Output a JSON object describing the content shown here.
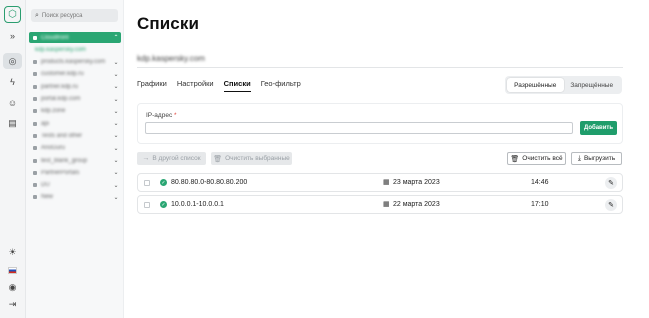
{
  "sidebar": {
    "search_placeholder": "Поиск ресурса",
    "domains": [
      {
        "label": "Cloudfront",
        "selected": true
      },
      {
        "label": "kdp.kaspersky.com",
        "sub": true
      },
      {
        "label": "products.kaspersky.com"
      },
      {
        "label": "customer.kdp.ru"
      },
      {
        "label": "partner.kdp.ru"
      },
      {
        "label": "portal.kdp.com"
      },
      {
        "label": "kdp.zone"
      },
      {
        "label": "api"
      },
      {
        "label": "Tests and other"
      },
      {
        "label": "AnoGuru"
      },
      {
        "label": "test_blank_group"
      },
      {
        "label": "PartnerPortals"
      },
      {
        "label": "DU"
      },
      {
        "label": "New"
      }
    ]
  },
  "page": {
    "title": "Списки",
    "domain": "kdp.kaspersky.com"
  },
  "tabs": [
    "Графики",
    "Настройки",
    "Списки",
    "Гео-фильтр"
  ],
  "segment": {
    "allowed": "Разрешённые",
    "denied": "Запрещённые"
  },
  "ip_form": {
    "label": "IP-адрес",
    "required_mark": "*",
    "value": "",
    "add_label": "Добавить"
  },
  "toolbar": {
    "move_label": "В другой список",
    "clear_selected_label": "Очистить выбранные",
    "clear_all_label": "Очистить всё",
    "export_label": "Выгрузить"
  },
  "entries": [
    {
      "range": "80.80.80.0-80.80.80.200",
      "date": "23 марта 2023",
      "time": "14:46"
    },
    {
      "range": "10.0.0.1-10.0.0.1",
      "date": "22 марта 2023",
      "time": "17:10"
    }
  ],
  "colors": {
    "accent": "#1f9d6b",
    "selected_domain": "#2aa673"
  }
}
